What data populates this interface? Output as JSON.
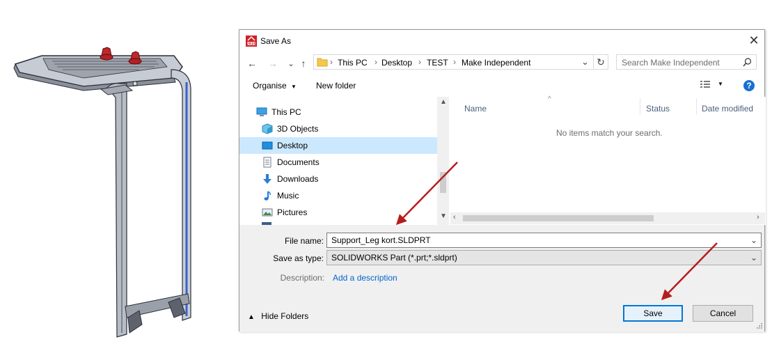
{
  "dialog": {
    "title": "Save As",
    "close_glyph": "✕",
    "app_icon": "solidworks-app-icon"
  },
  "nav": {
    "back_glyph": "←",
    "forward_glyph": "→",
    "recent_glyph": "⌄",
    "up_glyph": "↑",
    "breadcrumb": [
      "This PC",
      "Desktop",
      "TEST",
      "Make Independent"
    ],
    "breadcrumb_sep": "›",
    "refresh_glyph": "↻",
    "search_placeholder": "Search Make Independent"
  },
  "toolbar": {
    "organise_label": "Organise",
    "new_folder_label": "New folder",
    "help_glyph": "?"
  },
  "tree": {
    "items": [
      {
        "label": "This PC",
        "icon": "computer-icon"
      },
      {
        "label": "3D Objects",
        "icon": "3d-objects-icon"
      },
      {
        "label": "Desktop",
        "icon": "desktop-icon",
        "selected": true
      },
      {
        "label": "Documents",
        "icon": "documents-icon"
      },
      {
        "label": "Downloads",
        "icon": "downloads-icon"
      },
      {
        "label": "Music",
        "icon": "music-icon"
      },
      {
        "label": "Pictures",
        "icon": "pictures-icon"
      }
    ]
  },
  "files": {
    "columns": [
      "Name",
      "Status",
      "Date modified"
    ],
    "empty_message": "No items match your search."
  },
  "form": {
    "file_name_label": "File name:",
    "file_name_value": "Support_Leg kort.SLDPRT",
    "save_type_label": "Save as type:",
    "save_type_value": "SOLIDWORKS Part (*.prt;*.sldprt)",
    "description_label": "Description:",
    "description_link": "Add a description"
  },
  "footer": {
    "hide_folders_label": "Hide Folders",
    "save_label": "Save",
    "cancel_label": "Cancel"
  },
  "colors": {
    "accent": "#0066cc",
    "selection": "#cce8ff",
    "arrow": "#b71c1c"
  }
}
